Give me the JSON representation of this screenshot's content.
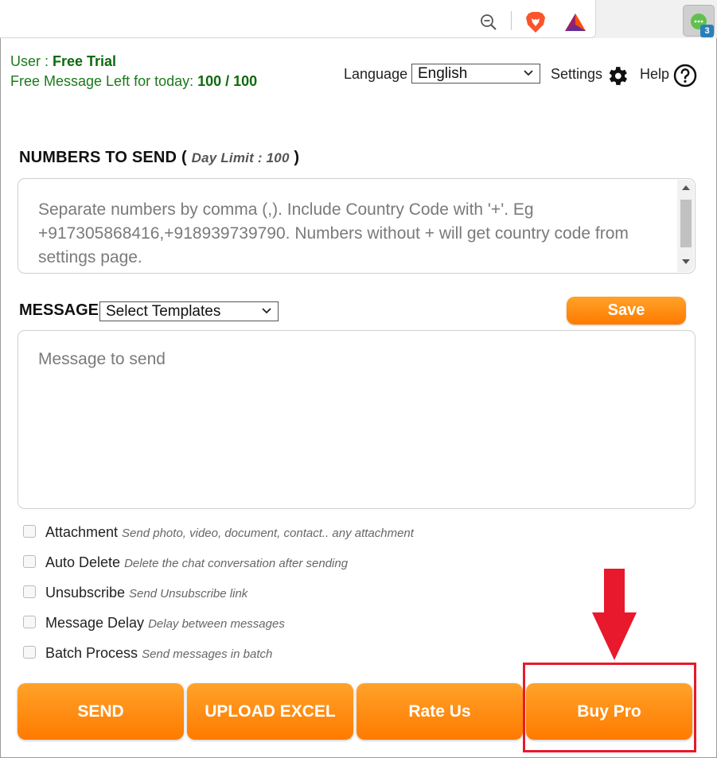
{
  "browser": {
    "zoom_icon": "zoom-out-icon",
    "brave_icon": "brave-lion-icon",
    "bat_icon": "bat-triangle-icon",
    "extension_badge": "3"
  },
  "header": {
    "user_label": "User : ",
    "user_value": "Free Trial",
    "free_label": "Free Message Left for today: ",
    "free_value": "100 / 100",
    "language_label": "Language",
    "language_value": "English",
    "settings_label": "Settings",
    "help_label": "Help"
  },
  "numbers": {
    "title": "NUMBERS TO SEND",
    "open_paren": "(",
    "day_limit": "Day Limit : 100",
    "close_paren": ")",
    "placeholder": "Separate numbers by comma (,). Include Country Code with '+'. Eg +917305868416,+918939739790. Numbers without + will get country code from settings page."
  },
  "message": {
    "title": "MESSAGE",
    "template_value": "Select Templates",
    "save_label": "Save",
    "placeholder": "Message to send"
  },
  "options": [
    {
      "label": "Attachment",
      "desc": "Send photo, video, document, contact.. any attachment"
    },
    {
      "label": "Auto Delete",
      "desc": "Delete the chat conversation after sending"
    },
    {
      "label": "Unsubscribe",
      "desc": "Send Unsubscribe link"
    },
    {
      "label": "Message Delay",
      "desc": "Delay between messages"
    },
    {
      "label": "Batch Process",
      "desc": "Send messages in batch"
    }
  ],
  "actions": {
    "send": "SEND",
    "upload": "UPLOAD EXCEL",
    "rate": "Rate Us",
    "buy": "Buy Pro"
  },
  "colors": {
    "accent_orange": "#ff8c1a",
    "green_text": "#1a7a1a",
    "highlight_red": "#e8192c"
  }
}
